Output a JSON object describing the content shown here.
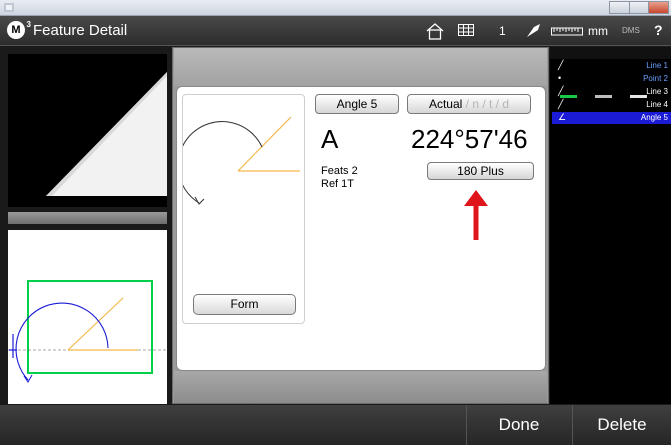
{
  "app": {
    "logo_letter": "M",
    "logo_super": "3",
    "title": "Feature Detail"
  },
  "toolbar": {
    "icons": [
      "home-icon",
      "table-icon",
      "probe-icon",
      "ruler-icon",
      "help-icon"
    ],
    "count": "1",
    "units": "mm",
    "angle_format": "DMS",
    "help": "?"
  },
  "feature": {
    "name_button": "Angle 5",
    "mode_label": "Actual",
    "mode_suffix": " / n / t / d",
    "letter": "A",
    "value": "224°57'46",
    "feats": "Feats 2",
    "ref": "Ref 1T",
    "plus_button": "180 Plus",
    "form_button": "Form"
  },
  "feature_list": [
    {
      "icon": "line-icon",
      "label": "Line 1",
      "color": "#6aa0ff",
      "selected": false
    },
    {
      "icon": "point-icon",
      "label": "Point 2",
      "color": "#6aa0ff",
      "selected": false
    },
    {
      "icon": "line-icon",
      "label": "Line 3",
      "color": "#ffffff",
      "selected": false
    },
    {
      "icon": "line-icon",
      "label": "Line 4",
      "color": "#ffffff",
      "selected": false
    },
    {
      "icon": "angle-icon",
      "label": "Angle 5",
      "color": "#ffffff",
      "selected": true
    }
  ],
  "footer": {
    "done": "Done",
    "delete": "Delete"
  },
  "colors": {
    "accent_blue": "#1b1bd6",
    "highlight_red": "#e0141b",
    "cad_green": "#00d04a",
    "diagram_orange": "#f4b84a"
  }
}
